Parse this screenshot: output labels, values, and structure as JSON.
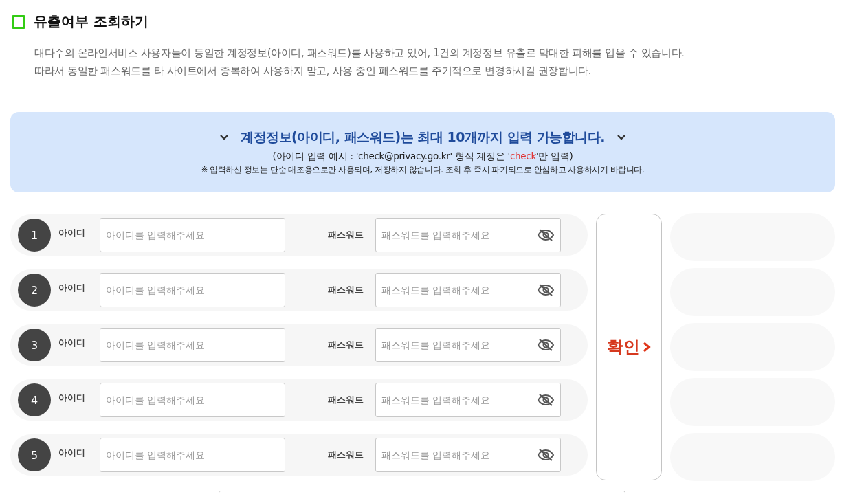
{
  "section": {
    "title": "유출여부 조회하기",
    "description": [
      "대다수의 온라인서비스 사용자들이 동일한 계정정보(아이디, 패스워드)를 사용하고 있어, 1건의 계정정보 유출로 막대한 피해를 입을 수 있습니다.",
      "따라서 동일한 패스워드를 타 사이트에서 중복하여 사용하지 말고, 사용 중인 패스워드를 주기적으로 변경하시길 권장합니다."
    ]
  },
  "notice": {
    "headline": "계정정보(아이디, 패스워드)는 최대 10개까지 입력 가능합니다.",
    "example": [
      "(아이디 입력 예시 : 'check@privacy.go.kr' 형식 계정은 '",
      "check",
      "'만 입력)"
    ],
    "note": "※ 입력하신 정보는 단순 대조용으로만 사용되며, 저장하지 않습니다. 조회 후 즉시 파기되므로 안심하고 사용하시기 바랍니다."
  },
  "accounts": [
    {
      "number": "1",
      "id_label": "아이디",
      "id_placeholder": "아이디를 입력해주세요",
      "pw_label": "패스워드",
      "pw_placeholder": "패스워드를 입력해주세요"
    },
    {
      "number": "2",
      "id_label": "아이디",
      "id_placeholder": "아이디를 입력해주세요",
      "pw_label": "패스워드",
      "pw_placeholder": "패스워드를 입력해주세요"
    },
    {
      "number": "3",
      "id_label": "아이디",
      "id_placeholder": "아이디를 입력해주세요",
      "pw_label": "패스워드",
      "pw_placeholder": "패스워드를 입력해주세요"
    },
    {
      "number": "4",
      "id_label": "아이디",
      "id_placeholder": "아이디를 입력해주세요",
      "pw_label": "패스워드",
      "pw_placeholder": "패스워드를 입력해주세요"
    },
    {
      "number": "5",
      "id_label": "아이디",
      "id_placeholder": "아이디를 입력해주세요",
      "pw_label": "패스워드",
      "pw_placeholder": "패스워드를 입력해주세요"
    }
  ],
  "confirm_button": {
    "label": "확인"
  }
}
